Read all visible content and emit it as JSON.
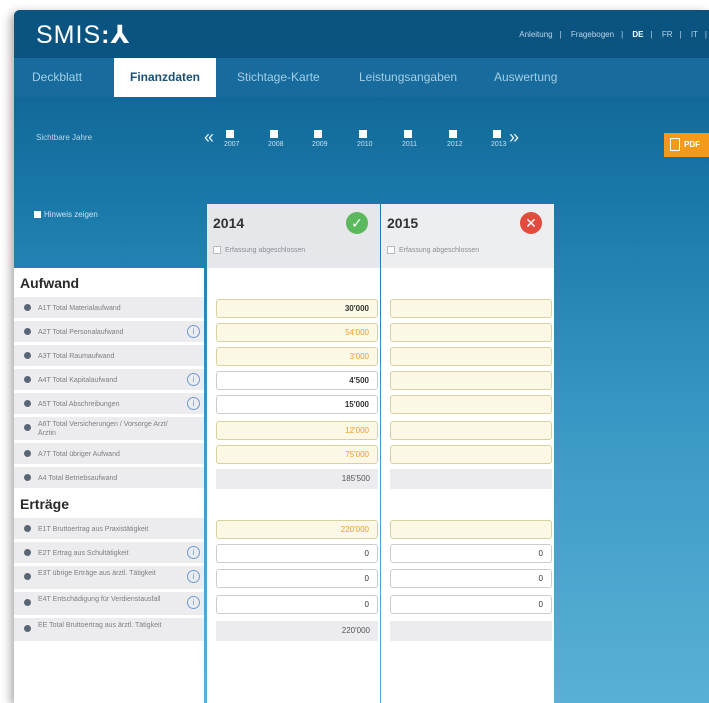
{
  "header": {
    "logo": "SMIS",
    "links": [
      "Anleitung",
      "Fragebogen",
      "DE",
      "FR",
      "IT"
    ],
    "active_lang": "DE"
  },
  "tabs": [
    "Deckblatt",
    "Finanzdaten",
    "Stichtage-Karte",
    "Leistungsangaben",
    "Auswertung"
  ],
  "active_tab": "Finanzdaten",
  "year_nav": {
    "label": "Sichtbare Jahre",
    "prev": "«",
    "next": "»",
    "years": [
      "2007",
      "2008",
      "2009",
      "2010",
      "2011",
      "2012",
      "2013"
    ]
  },
  "pdf_button": "PDF",
  "show_hint": "Hinweis zeigen",
  "columns": [
    {
      "year": "2014",
      "status": "ok",
      "status_symbol": "✓",
      "closed_label": "Erfassung abgeschlossen"
    },
    {
      "year": "2015",
      "status": "error",
      "status_symbol": "✕",
      "closed_label": "Erfassung abgeschlossen"
    }
  ],
  "sections": {
    "aufwand": {
      "title": "Aufwand",
      "rows": [
        {
          "label": "A1T Total Materialaufwand",
          "v2014": "30'000"
        },
        {
          "label": "A2T Total Personalaufwand",
          "v2014": "54'000"
        },
        {
          "label": "A3T Total Raumaufwand",
          "v2014": "3'000"
        },
        {
          "label": "A4T Total Kapitalaufwand",
          "v2014": "4'500"
        },
        {
          "label": "A5T Total Abschreibungen",
          "v2014": "15'000"
        },
        {
          "label": "A6T Total Versicherungen / Vorsorge Arzt/Ärztin",
          "v2014": "12'000"
        },
        {
          "label": "A7T Total übriger Aufwand",
          "v2014": "75'000"
        }
      ],
      "total": {
        "label": "A4 Total Betriebsaufwand",
        "v2014": "185'500"
      }
    },
    "ertraege": {
      "title": "Erträge",
      "rows": [
        {
          "label": "E1T Bruttoertrag aus Praxistätigkeit",
          "v2014": "220'000",
          "v2015": ""
        },
        {
          "label": "E2T Ertrag aus Schultätigkeit",
          "v2014": "0",
          "v2015": "0"
        },
        {
          "label": "E3T übrige Erträge aus ärztl. Tätigkeit",
          "v2014": "0",
          "v2015": "0"
        },
        {
          "label": "E4T Entschädigung für Verdienstausfall",
          "v2014": "0",
          "v2015": "0"
        }
      ],
      "total": {
        "label": "EE Total Bruttoertrag aus ärztl. Tätigkeit",
        "v2014": "220'000"
      }
    }
  }
}
